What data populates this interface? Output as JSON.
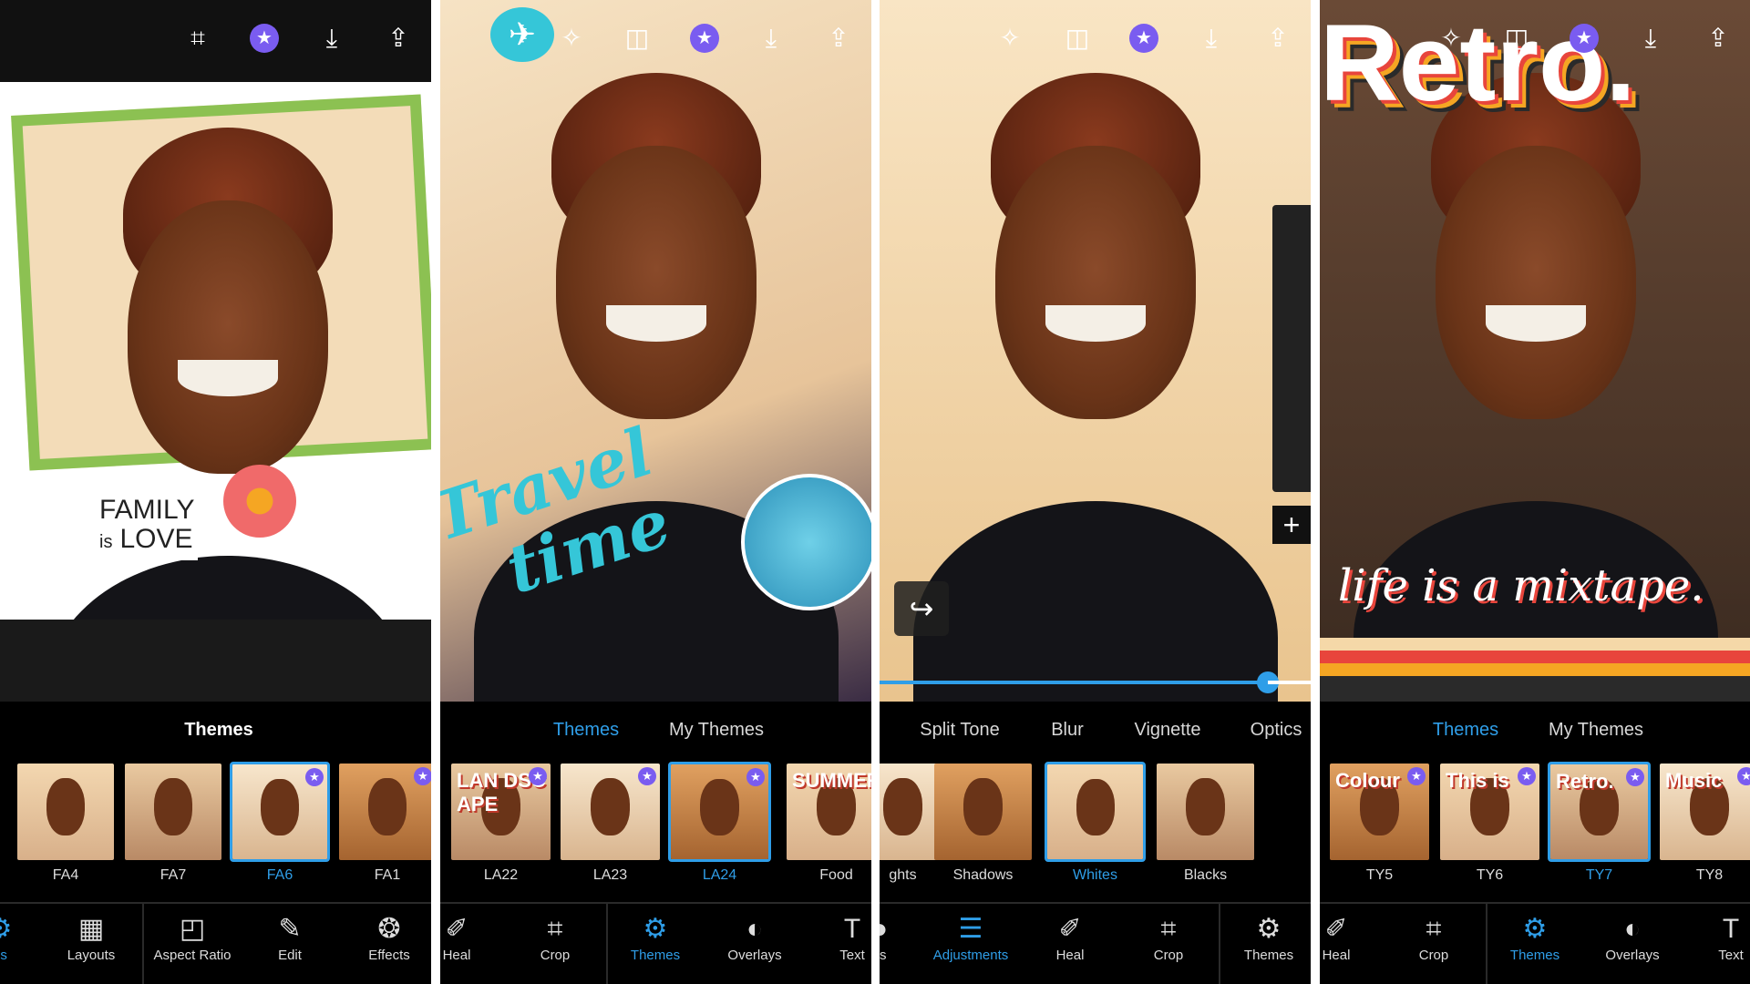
{
  "colors": {
    "accent": "#2f9ee8",
    "premium": "#7a5cf0",
    "background": "#000000"
  },
  "panels": [
    {
      "top_icons": [
        "scan-icon",
        "premium-star-icon",
        "download-icon",
        "share-icon"
      ],
      "tabs": [
        {
          "label": "Themes",
          "active": false
        }
      ],
      "thumbs": [
        {
          "label": "FA4",
          "active": false,
          "premium": false
        },
        {
          "label": "FA7",
          "active": false,
          "premium": false
        },
        {
          "label": "FA6",
          "active": true,
          "premium": true
        },
        {
          "label": "FA1",
          "active": false,
          "premium": true
        }
      ],
      "nav": [
        {
          "label": "es",
          "icon": "themes-icon",
          "active": true
        },
        {
          "label": "Layouts",
          "icon": "layouts-icon",
          "active": false
        },
        {
          "label": "Aspect Ratio",
          "icon": "aspect-ratio-icon",
          "active": false
        },
        {
          "label": "Edit",
          "icon": "pencil-icon",
          "active": false
        },
        {
          "label": "Effects",
          "icon": "effects-icon",
          "active": false
        }
      ],
      "overlay": {
        "line1": "FAMILY",
        "line2": "is",
        "line3": "LOVE"
      }
    },
    {
      "top_icons": [
        "magic-wand-icon",
        "compare-icon",
        "premium-star-icon",
        "download-icon",
        "share-icon"
      ],
      "tabs": [
        {
          "label": "Themes",
          "active": true
        },
        {
          "label": "My Themes",
          "active": false
        }
      ],
      "thumbs": [
        {
          "label": "LA22",
          "active": false,
          "premium": true,
          "text": "LAN DSC APE"
        },
        {
          "label": "LA23",
          "active": false,
          "premium": true
        },
        {
          "label": "LA24",
          "active": true,
          "premium": true
        },
        {
          "label": "Food",
          "active": false,
          "premium": false,
          "text": "SUMMER"
        }
      ],
      "nav": [
        {
          "label": "Heal",
          "icon": "bandage-icon",
          "active": false
        },
        {
          "label": "Crop",
          "icon": "crop-icon",
          "active": false
        },
        {
          "label": "Themes",
          "icon": "themes-icon",
          "active": true
        },
        {
          "label": "Overlays",
          "icon": "overlays-icon",
          "active": false
        },
        {
          "label": "Text",
          "icon": "text-icon",
          "active": false
        }
      ],
      "overlay": {
        "line1": "Travel",
        "line2": "time"
      }
    },
    {
      "top_icons": [
        "magic-wand-icon",
        "compare-icon",
        "premium-star-icon",
        "download-icon",
        "share-icon"
      ],
      "tabs": [
        {
          "label": "Split Tone",
          "active": false
        },
        {
          "label": "Blur",
          "active": false
        },
        {
          "label": "Vignette",
          "active": false
        },
        {
          "label": "Optics",
          "active": false
        }
      ],
      "thumbs": [
        {
          "label": "ghts",
          "active": false,
          "premium": false
        },
        {
          "label": "Shadows",
          "active": false,
          "premium": false
        },
        {
          "label": "Whites",
          "active": true,
          "premium": false
        },
        {
          "label": "Blacks",
          "active": false,
          "premium": false
        }
      ],
      "nav": [
        {
          "label": "ks",
          "icon": "looks-icon",
          "active": false
        },
        {
          "label": "Adjustments",
          "icon": "sliders-icon",
          "active": true
        },
        {
          "label": "Heal",
          "icon": "bandage-icon",
          "active": false
        },
        {
          "label": "Crop",
          "icon": "crop-icon",
          "active": false
        },
        {
          "label": "Themes",
          "icon": "themes-icon",
          "active": false
        }
      ],
      "slider_value": 0.9
    },
    {
      "top_icons": [
        "magic-wand-icon",
        "compare-icon",
        "premium-star-icon",
        "download-icon",
        "share-icon"
      ],
      "tabs": [
        {
          "label": "Themes",
          "active": true
        },
        {
          "label": "My Themes",
          "active": false
        }
      ],
      "thumbs": [
        {
          "label": "TY5",
          "active": false,
          "premium": true,
          "text": "Colour"
        },
        {
          "label": "TY6",
          "active": false,
          "premium": true,
          "text": "This is"
        },
        {
          "label": "TY7",
          "active": true,
          "premium": true,
          "text": "Retro."
        },
        {
          "label": "TY8",
          "active": false,
          "premium": true,
          "text": "Music"
        }
      ],
      "nav": [
        {
          "label": "Heal",
          "icon": "bandage-icon",
          "active": false
        },
        {
          "label": "Crop",
          "icon": "crop-icon",
          "active": false
        },
        {
          "label": "Themes",
          "icon": "themes-icon",
          "active": true
        },
        {
          "label": "Overlays",
          "icon": "overlays-icon",
          "active": false
        },
        {
          "label": "Text",
          "icon": "text-icon",
          "active": false
        }
      ],
      "overlay": {
        "line1": "Retro.",
        "line2": "life is a mixtape."
      }
    }
  ]
}
